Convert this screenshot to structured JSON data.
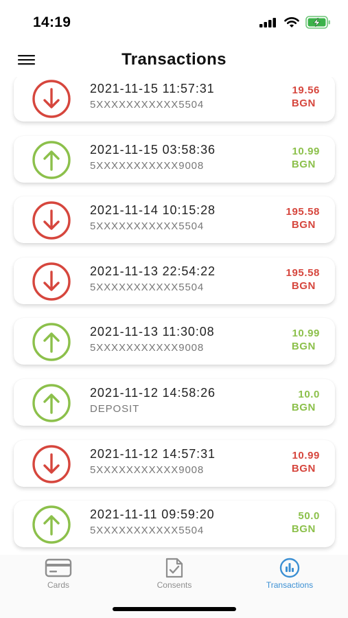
{
  "status_bar": {
    "time": "14:19",
    "signal_icon": "cellular-signal-icon",
    "wifi_icon": "wifi-icon",
    "battery_icon": "battery-charging-icon"
  },
  "header": {
    "menu_icon": "hamburger-menu-icon",
    "title": "Transactions"
  },
  "colors": {
    "outgoing": "#d6463d",
    "incoming": "#8cc04b",
    "tab_active": "#3b8fd3",
    "tab_inactive": "#8e8e8e"
  },
  "transactions": [
    {
      "direction": "out",
      "icon": "arrow-down-circle-icon",
      "datetime": "2021-11-15 11:57:31",
      "detail": "5XXXXXXXXXXX5504",
      "amount": "19.56",
      "currency": "BGN"
    },
    {
      "direction": "in",
      "icon": "arrow-up-circle-icon",
      "datetime": "2021-11-15 03:58:36",
      "detail": "5XXXXXXXXXXX9008",
      "amount": "10.99",
      "currency": "BGN"
    },
    {
      "direction": "out",
      "icon": "arrow-down-circle-icon",
      "datetime": "2021-11-14 10:15:28",
      "detail": "5XXXXXXXXXXX5504",
      "amount": "195.58",
      "currency": "BGN"
    },
    {
      "direction": "out",
      "icon": "arrow-down-circle-icon",
      "datetime": "2021-11-13 22:54:22",
      "detail": "5XXXXXXXXXXX5504",
      "amount": "195.58",
      "currency": "BGN"
    },
    {
      "direction": "in",
      "icon": "arrow-up-circle-icon",
      "datetime": "2021-11-13 11:30:08",
      "detail": "5XXXXXXXXXXX9008",
      "amount": "10.99",
      "currency": "BGN"
    },
    {
      "direction": "in",
      "icon": "arrow-up-circle-icon",
      "datetime": "2021-11-12 14:58:26",
      "detail": "DEPOSIT",
      "amount": "10.0",
      "currency": "BGN"
    },
    {
      "direction": "out",
      "icon": "arrow-down-circle-icon",
      "datetime": "2021-11-12 14:57:31",
      "detail": "5XXXXXXXXXXX9008",
      "amount": "10.99",
      "currency": "BGN"
    },
    {
      "direction": "in",
      "icon": "arrow-up-circle-icon",
      "datetime": "2021-11-11 09:59:20",
      "detail": "5XXXXXXXXXXX5504",
      "amount": "50.0",
      "currency": "BGN"
    }
  ],
  "tab_bar": {
    "active": "transactions",
    "tabs": [
      {
        "id": "cards",
        "label": "Cards",
        "icon": "credit-card-icon"
      },
      {
        "id": "consents",
        "label": "Consents",
        "icon": "document-check-icon"
      },
      {
        "id": "transactions",
        "label": "Transactions",
        "icon": "bar-chart-circle-icon"
      }
    ]
  }
}
